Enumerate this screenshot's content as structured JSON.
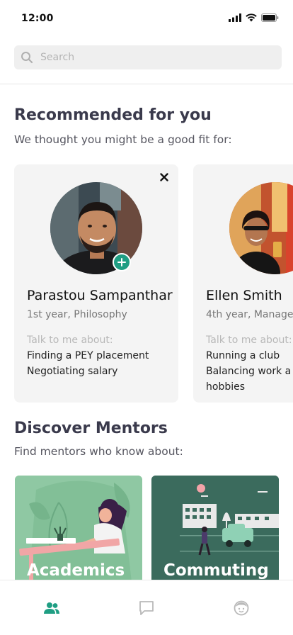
{
  "status": {
    "time": "12:00"
  },
  "search": {
    "placeholder": "Search"
  },
  "recommended": {
    "title": "Recommended for you",
    "subtitle": "We thought you might be a good fit for:",
    "talk_label": "Talk to me about:",
    "mentors": [
      {
        "name": "Parastou Sampanthar",
        "year": "1st year, Philosophy",
        "topics": [
          "Finding a PEY placement",
          "Negotiating salary"
        ]
      },
      {
        "name": "Ellen Smith",
        "year": "4th year, Manage",
        "topics": [
          "Running a club",
          "Balancing work a",
          "hobbies"
        ]
      }
    ]
  },
  "discover": {
    "title": "Discover Mentors",
    "subtitle": "Find mentors who know about:",
    "categories": [
      {
        "label": "Academics",
        "color": "#8fc8a3"
      },
      {
        "label": "Commuting",
        "color": "#3b6b5d"
      }
    ]
  },
  "tabs": [
    {
      "icon": "people-icon",
      "active": true
    },
    {
      "icon": "chat-icon",
      "active": false
    },
    {
      "icon": "profile-face-icon",
      "active": false
    }
  ],
  "colors": {
    "accent": "#1f9e83",
    "tab_inactive": "#b9b9b9"
  }
}
